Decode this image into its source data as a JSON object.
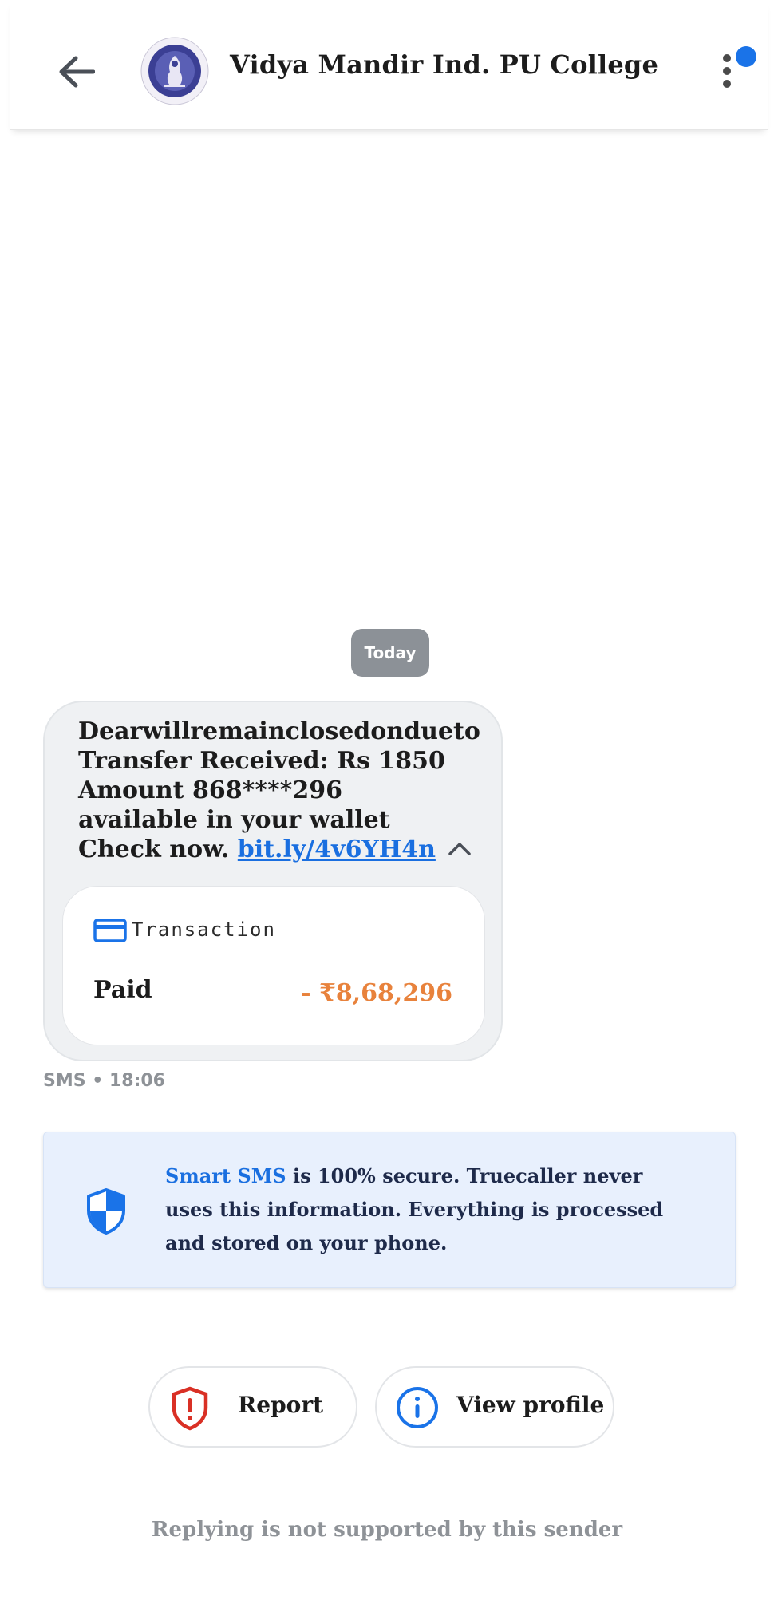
{
  "header": {
    "sender_name": "Vidya Mandir Ind. PU College",
    "notification_color": "#1a73e8"
  },
  "conversation": {
    "date_chip": "Today",
    "message": {
      "text": "Dearwillremainclosedondueto Transfer Received: Rs 1850 Amount 868****296 available in your wallet Check now. ",
      "link_text": "bit.ly/4v6YH4n",
      "meta": "SMS • 18:06"
    },
    "transaction": {
      "label": "Transaction",
      "status": "Paid",
      "amount": "- ₹8,68,296",
      "amount_color": "#e8823c"
    }
  },
  "secure_banner": {
    "highlight": "Smart SMS",
    "text": " is 100% secure. Truecaller never uses this information. Everything is processed and stored on your phone."
  },
  "actions": {
    "report_label": "Report",
    "view_profile_label": "View profile"
  },
  "footer": {
    "note": "Replying is not supported by this sender"
  },
  "icons": {
    "back": "arrow-left-icon",
    "menu": "more-vertical-icon",
    "collapse": "chevron-up-icon",
    "card": "credit-card-icon",
    "shield": "shield-icon",
    "report": "alert-shield-icon",
    "info": "info-icon"
  }
}
